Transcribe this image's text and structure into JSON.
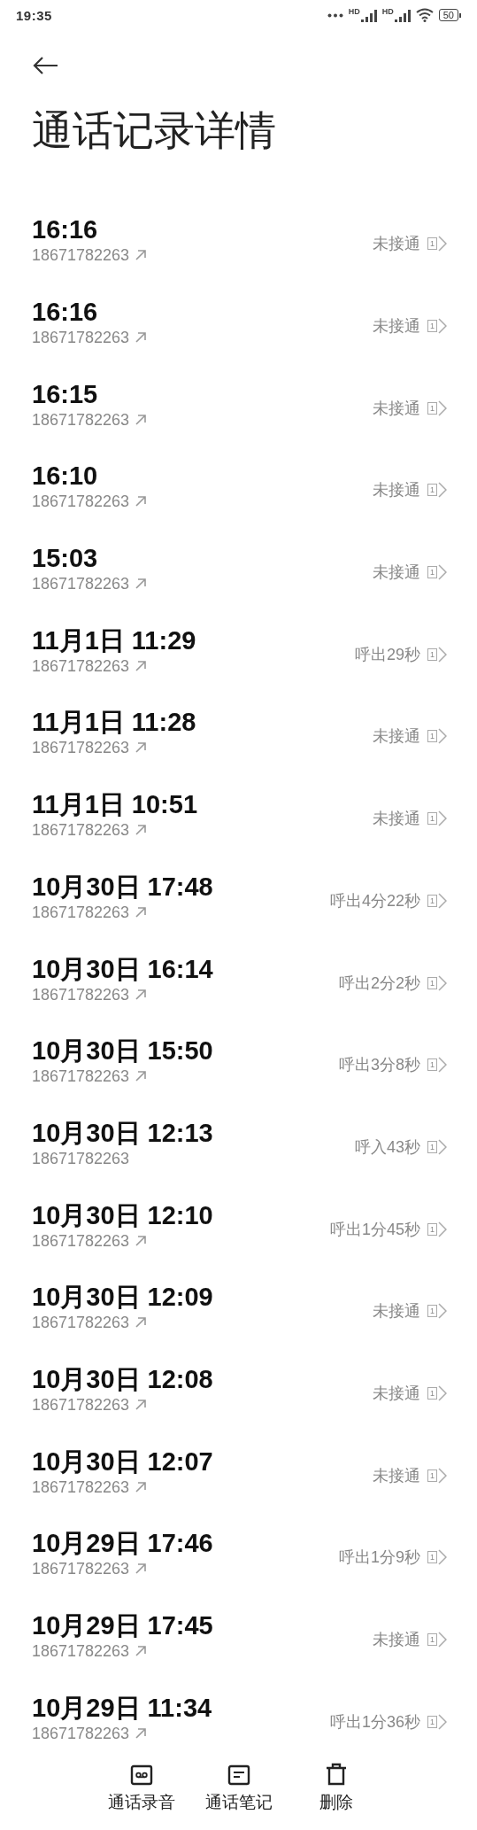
{
  "status_bar": {
    "time": "19:35",
    "signals": [
      {
        "label": "HD"
      },
      {
        "label": "HD"
      }
    ],
    "battery": "50"
  },
  "title": "通话记录详情",
  "calls": [
    {
      "time": "16:16",
      "number": "18671782263",
      "kind": "outgoing",
      "result": "未接通",
      "sim": "1"
    },
    {
      "time": "16:16",
      "number": "18671782263",
      "kind": "outgoing",
      "result": "未接通",
      "sim": "1"
    },
    {
      "time": "16:15",
      "number": "18671782263",
      "kind": "outgoing",
      "result": "未接通",
      "sim": "1"
    },
    {
      "time": "16:10",
      "number": "18671782263",
      "kind": "outgoing",
      "result": "未接通",
      "sim": "1"
    },
    {
      "time": "15:03",
      "number": "18671782263",
      "kind": "outgoing",
      "result": "未接通",
      "sim": "1"
    },
    {
      "time": "11月1日 11:29",
      "number": "18671782263",
      "kind": "outgoing",
      "result": "呼出29秒",
      "sim": "1"
    },
    {
      "time": "11月1日 11:28",
      "number": "18671782263",
      "kind": "outgoing",
      "result": "未接通",
      "sim": "1"
    },
    {
      "time": "11月1日 10:51",
      "number": "18671782263",
      "kind": "outgoing",
      "result": "未接通",
      "sim": "1"
    },
    {
      "time": "10月30日 17:48",
      "number": "18671782263",
      "kind": "outgoing",
      "result": "呼出4分22秒",
      "sim": "1"
    },
    {
      "time": "10月30日 16:14",
      "number": "18671782263",
      "kind": "outgoing",
      "result": "呼出2分2秒",
      "sim": "1"
    },
    {
      "time": "10月30日 15:50",
      "number": "18671782263",
      "kind": "outgoing",
      "result": "呼出3分8秒",
      "sim": "1"
    },
    {
      "time": "10月30日 12:13",
      "number": "18671782263",
      "kind": "incoming",
      "result": "呼入43秒",
      "sim": "1"
    },
    {
      "time": "10月30日 12:10",
      "number": "18671782263",
      "kind": "outgoing",
      "result": "呼出1分45秒",
      "sim": "1"
    },
    {
      "time": "10月30日 12:09",
      "number": "18671782263",
      "kind": "outgoing",
      "result": "未接通",
      "sim": "1"
    },
    {
      "time": "10月30日 12:08",
      "number": "18671782263",
      "kind": "outgoing",
      "result": "未接通",
      "sim": "1"
    },
    {
      "time": "10月30日 12:07",
      "number": "18671782263",
      "kind": "outgoing",
      "result": "未接通",
      "sim": "1"
    },
    {
      "time": "10月29日 17:46",
      "number": "18671782263",
      "kind": "outgoing",
      "result": "呼出1分9秒",
      "sim": "1"
    },
    {
      "time": "10月29日 17:45",
      "number": "18671782263",
      "kind": "outgoing",
      "result": "未接通",
      "sim": "1"
    },
    {
      "time": "10月29日 11:34",
      "number": "18671782263",
      "kind": "outgoing",
      "result": "呼出1分36秒",
      "sim": "1"
    }
  ],
  "actions": [
    {
      "label": "通话录音",
      "kind": "recording"
    },
    {
      "label": "通话笔记",
      "kind": "notes"
    },
    {
      "label": "删除",
      "kind": "delete"
    }
  ]
}
